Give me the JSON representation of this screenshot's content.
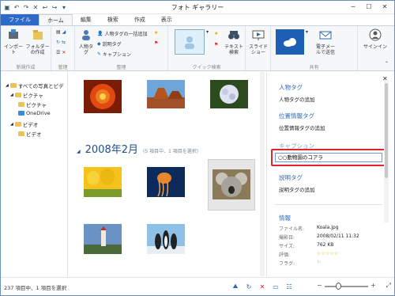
{
  "window": {
    "title": "フォト ギャラリー"
  },
  "tabs": [
    "ファイル",
    "ホーム",
    "編集",
    "検索",
    "作成",
    "表示"
  ],
  "ribbon": {
    "new_group": {
      "import": "インポート",
      "add_folder": "フォルダーの作成",
      "label": "新規作成"
    },
    "manage_label": "管理",
    "organize": {
      "people": "人物タグ",
      "people_batch": "人物タグの一括追加",
      "descriptive": "説明タグ",
      "caption": "キャプション",
      "label": "整理"
    },
    "quickfind_label": "クイック検索",
    "text_search": "テキスト検索",
    "slideshow": "スライドショー",
    "share_label": "共有",
    "email": "電子メールで送信",
    "signin": "サインイン"
  },
  "nav": {
    "items": [
      {
        "label": "すべての写真とビデ"
      },
      {
        "label": "ピクチャ"
      },
      {
        "label": "ピクチャ"
      },
      {
        "label": "OneDrive"
      },
      {
        "label": "ビデオ"
      },
      {
        "label": "ビデオ"
      }
    ]
  },
  "content": {
    "group_title": "2008年2月",
    "group_count": "(5 項目中、1 項目を選択)"
  },
  "pane": {
    "people_tag": "人物タグ",
    "people_add": "人物タグの追加",
    "geo_tag": "位置情報タグ",
    "geo_add": "位置情報タグの追加",
    "caption_label": "キャプション",
    "caption_value": "○○動物園のコアラ",
    "desc_tag": "説明タグ",
    "desc_add": "説明タグの追加",
    "info_title": "情報",
    "info": [
      {
        "k": "ファイル名:",
        "v": "Koala.jpg"
      },
      {
        "k": "撮影日:",
        "v": "2008/02/11  11:32"
      },
      {
        "k": "サイズ:",
        "v": "762 KB"
      },
      {
        "k": "評価:",
        "v": "☆☆☆☆☆"
      },
      {
        "k": "フラグ:",
        "v": "⚐"
      }
    ]
  },
  "status": {
    "text": "237 項目中、1 項目を選択"
  },
  "colors": {
    "accent": "#2e6bc6",
    "highlight": "#e3262b"
  }
}
